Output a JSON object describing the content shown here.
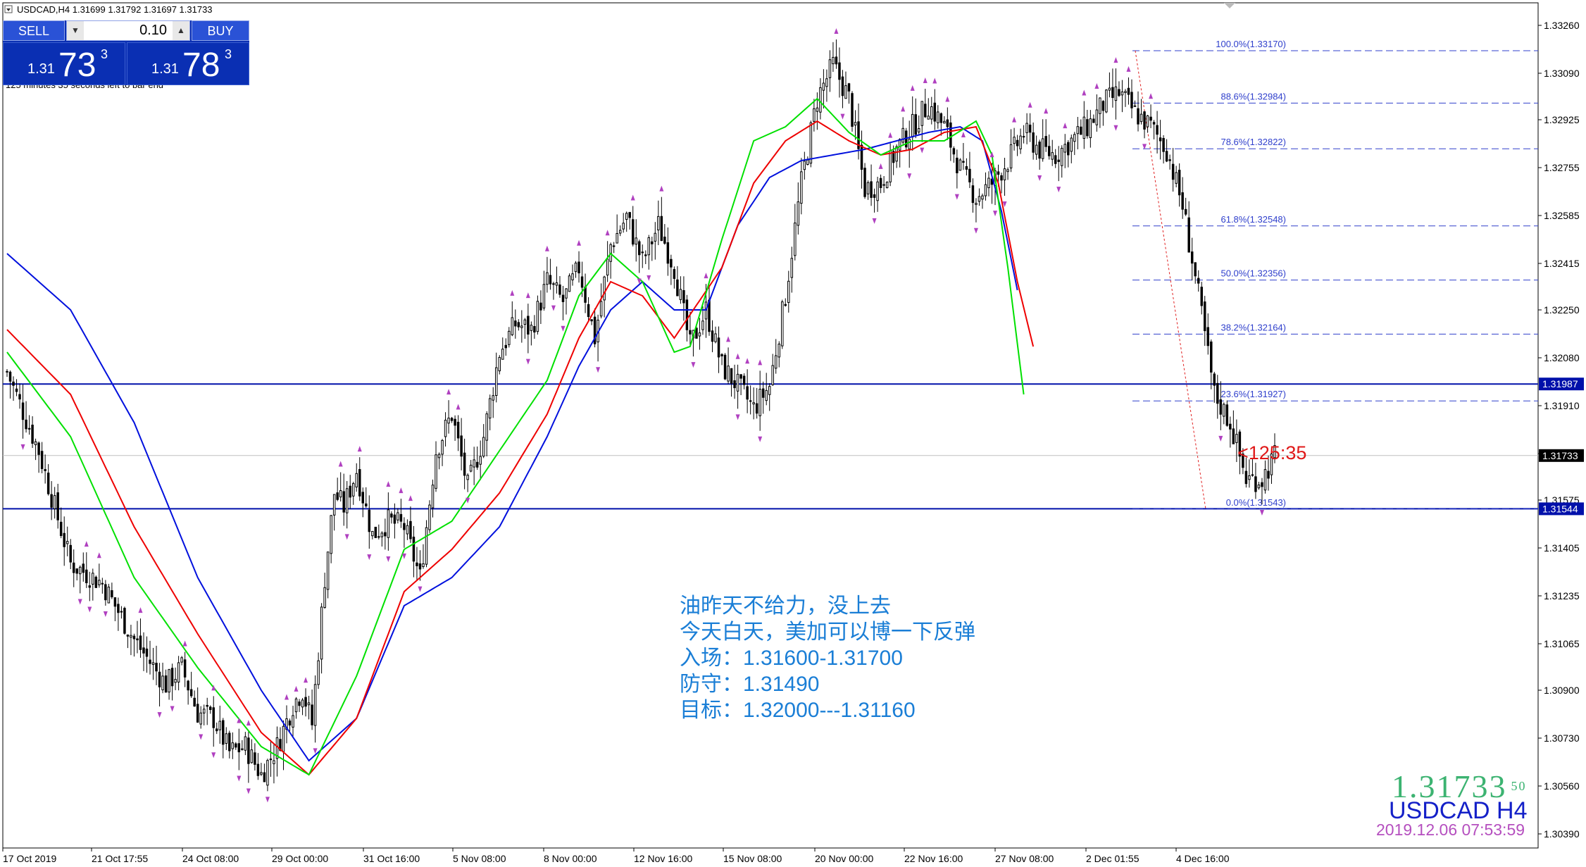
{
  "window": {
    "title": "USDCAD,H4  1.31699 1.31792 1.31697 1.31733"
  },
  "trade_panel": {
    "sell_label": "SELL",
    "buy_label": "BUY",
    "lot_value": "0.10",
    "sell_price_small": "1.31",
    "sell_price_big": "73",
    "sell_price_sup": "3",
    "buy_price_small": "1.31",
    "buy_price_big": "78",
    "buy_price_sup": "3",
    "bar_info": "125 minutes 35 seconds left to bar end"
  },
  "countdown": "<125:35",
  "note": {
    "lines": [
      "油昨天不给力，没上去",
      "今天白天，美加可以博一下反弹",
      "入场：1.31600-1.31700",
      "防守：1.31490",
      "目标：1.32000---1.31160"
    ]
  },
  "big_display": {
    "price": "1.31733",
    "price_tail": "50",
    "symbol": "USDCAD H4",
    "datetime": "2019.12.06 07:53:59"
  },
  "colors": {
    "candle": "#000000",
    "ma_fast": "#00e000",
    "ma_mid": "#ee0000",
    "ma_slow": "#0010dd",
    "hline": "#0010aa",
    "fib": "#3040cc",
    "fractal": "#b040c0",
    "price_label_bg": "#000000",
    "level_label_bg": "#0010aa"
  },
  "chart_data": {
    "type": "candlestick",
    "symbol": "USDCAD",
    "timeframe": "H4",
    "ylim": [
      1.3034,
      1.3334
    ],
    "y_ticks": [
      "1.33260",
      "1.33090",
      "1.32925",
      "1.32755",
      "1.32585",
      "1.32415",
      "1.32250",
      "1.32080",
      "1.31910",
      "1.31740",
      "1.31575",
      "1.31405",
      "1.31235",
      "1.31065",
      "1.30900",
      "1.30730",
      "1.30560",
      "1.30390"
    ],
    "x_ticks": [
      "17 Oct 2019",
      "21 Oct 17:55",
      "24 Oct 08:00",
      "29 Oct 00:00",
      "31 Oct 16:00",
      "5 Nov 08:00",
      "8 Nov 00:00",
      "12 Nov 16:00",
      "15 Nov 08:00",
      "20 Nov 00:00",
      "22 Nov 16:00",
      "27 Nov 08:00",
      "2 Dec 01:55",
      "4 Dec 16:00"
    ],
    "current_price": "1.31733",
    "horizontal_levels": [
      {
        "value": 1.31987,
        "label": "1.31987"
      },
      {
        "value": 1.31544,
        "label": "1.31544"
      }
    ],
    "fibonacci": [
      {
        "level": "100.0%",
        "value": 1.3317,
        "label": "100.0%(1.33170)"
      },
      {
        "level": "88.6%",
        "value": 1.32984,
        "label": "88.6%(1.32984)"
      },
      {
        "level": "78.6%",
        "value": 1.32822,
        "label": "78.6%(1.32822)"
      },
      {
        "level": "61.8%",
        "value": 1.32548,
        "label": "61.8%(1.32548)"
      },
      {
        "level": "50.0%",
        "value": 1.32356,
        "label": "50.0%(1.32356)"
      },
      {
        "level": "38.2%",
        "value": 1.32164,
        "label": "38.2%(1.32164)"
      },
      {
        "level": "23.6%",
        "value": 1.31927,
        "label": "23.6%(1.31927)"
      },
      {
        "level": "0.0%",
        "value": 1.31543,
        "label": "0.0%(1.31543)"
      }
    ],
    "close_path": [
      [
        0,
        1.3203
      ],
      [
        10,
        1.3175
      ],
      [
        20,
        1.3135
      ],
      [
        30,
        1.3128
      ],
      [
        40,
        1.3108
      ],
      [
        50,
        1.3092
      ],
      [
        55,
        1.3098
      ],
      [
        60,
        1.3082
      ],
      [
        65,
        1.308
      ],
      [
        70,
        1.3068
      ],
      [
        75,
        1.307
      ],
      [
        80,
        1.306
      ],
      [
        85,
        1.307
      ],
      [
        90,
        1.3085
      ],
      [
        93,
        1.309
      ],
      [
        96,
        1.3078
      ],
      [
        100,
        1.313
      ],
      [
        103,
        1.316
      ],
      [
        106,
        1.3155
      ],
      [
        110,
        1.3168
      ],
      [
        115,
        1.3145
      ],
      [
        120,
        1.315
      ],
      [
        125,
        1.3148
      ],
      [
        130,
        1.313
      ],
      [
        135,
        1.3175
      ],
      [
        140,
        1.3188
      ],
      [
        145,
        1.3162
      ],
      [
        150,
        1.318
      ],
      [
        155,
        1.321
      ],
      [
        160,
        1.322
      ],
      [
        165,
        1.3218
      ],
      [
        170,
        1.3235
      ],
      [
        175,
        1.3228
      ],
      [
        180,
        1.324
      ],
      [
        185,
        1.3215
      ],
      [
        190,
        1.3248
      ],
      [
        195,
        1.3258
      ],
      [
        200,
        1.3242
      ],
      [
        205,
        1.3255
      ],
      [
        210,
        1.324
      ],
      [
        215,
        1.3212
      ],
      [
        220,
        1.3225
      ],
      [
        225,
        1.3205
      ],
      [
        230,
        1.3198
      ],
      [
        235,
        1.319
      ],
      [
        240,
        1.3198
      ],
      [
        245,
        1.323
      ],
      [
        250,
        1.327
      ],
      [
        255,
        1.33
      ],
      [
        260,
        1.3312
      ],
      [
        265,
        1.33
      ],
      [
        270,
        1.3268
      ],
      [
        275,
        1.327
      ],
      [
        280,
        1.3282
      ],
      [
        285,
        1.329
      ],
      [
        290,
        1.3298
      ],
      [
        295,
        1.329
      ],
      [
        300,
        1.3275
      ],
      [
        305,
        1.3265
      ],
      [
        310,
        1.327
      ],
      [
        315,
        1.3278
      ],
      [
        320,
        1.3288
      ],
      [
        325,
        1.3282
      ],
      [
        330,
        1.328
      ],
      [
        335,
        1.3285
      ],
      [
        340,
        1.329
      ],
      [
        345,
        1.3298
      ],
      [
        350,
        1.3302
      ],
      [
        355,
        1.3295
      ],
      [
        360,
        1.329
      ],
      [
        365,
        1.3282
      ],
      [
        370,
        1.3262
      ],
      [
        375,
        1.323
      ],
      [
        380,
        1.3195
      ],
      [
        385,
        1.3185
      ],
      [
        390,
        1.3165
      ],
      [
        395,
        1.3165
      ],
      [
        399,
        1.3173
      ]
    ],
    "ma_fast_path": [
      [
        0,
        1.321
      ],
      [
        20,
        1.318
      ],
      [
        40,
        1.313
      ],
      [
        60,
        1.3098
      ],
      [
        80,
        1.307
      ],
      [
        95,
        1.306
      ],
      [
        110,
        1.3095
      ],
      [
        125,
        1.314
      ],
      [
        140,
        1.315
      ],
      [
        155,
        1.3175
      ],
      [
        170,
        1.32
      ],
      [
        180,
        1.323
      ],
      [
        190,
        1.3245
      ],
      [
        200,
        1.3235
      ],
      [
        210,
        1.321
      ],
      [
        215,
        1.3212
      ],
      [
        225,
        1.325
      ],
      [
        235,
        1.3285
      ],
      [
        245,
        1.329
      ],
      [
        255,
        1.33
      ],
      [
        265,
        1.3288
      ],
      [
        275,
        1.328
      ],
      [
        285,
        1.3285
      ],
      [
        295,
        1.3285
      ],
      [
        305,
        1.3292
      ],
      [
        310,
        1.328
      ],
      [
        315,
        1.324
      ],
      [
        320,
        1.3195
      ]
    ],
    "ma_mid_path": [
      [
        0,
        1.3218
      ],
      [
        20,
        1.3195
      ],
      [
        40,
        1.3148
      ],
      [
        60,
        1.311
      ],
      [
        80,
        1.3075
      ],
      [
        95,
        1.306
      ],
      [
        110,
        1.308
      ],
      [
        125,
        1.3125
      ],
      [
        140,
        1.314
      ],
      [
        155,
        1.316
      ],
      [
        170,
        1.3188
      ],
      [
        180,
        1.3215
      ],
      [
        190,
        1.3235
      ],
      [
        200,
        1.323
      ],
      [
        210,
        1.3215
      ],
      [
        225,
        1.324
      ],
      [
        235,
        1.327
      ],
      [
        245,
        1.3285
      ],
      [
        255,
        1.3292
      ],
      [
        265,
        1.3285
      ],
      [
        275,
        1.328
      ],
      [
        285,
        1.3282
      ],
      [
        295,
        1.3288
      ],
      [
        305,
        1.329
      ],
      [
        312,
        1.327
      ],
      [
        318,
        1.3235
      ],
      [
        323,
        1.3212
      ]
    ],
    "ma_slow_path": [
      [
        0,
        1.3245
      ],
      [
        20,
        1.3225
      ],
      [
        40,
        1.3185
      ],
      [
        60,
        1.313
      ],
      [
        80,
        1.309
      ],
      [
        95,
        1.3065
      ],
      [
        110,
        1.308
      ],
      [
        125,
        1.312
      ],
      [
        140,
        1.313
      ],
      [
        155,
        1.3148
      ],
      [
        170,
        1.318
      ],
      [
        180,
        1.3205
      ],
      [
        190,
        1.3225
      ],
      [
        200,
        1.3235
      ],
      [
        210,
        1.3225
      ],
      [
        220,
        1.3225
      ],
      [
        230,
        1.3255
      ],
      [
        240,
        1.3272
      ],
      [
        250,
        1.3278
      ],
      [
        260,
        1.328
      ],
      [
        270,
        1.3282
      ],
      [
        280,
        1.3285
      ],
      [
        290,
        1.3288
      ],
      [
        300,
        1.329
      ],
      [
        307,
        1.3285
      ],
      [
        313,
        1.326
      ],
      [
        318,
        1.3232
      ]
    ]
  }
}
